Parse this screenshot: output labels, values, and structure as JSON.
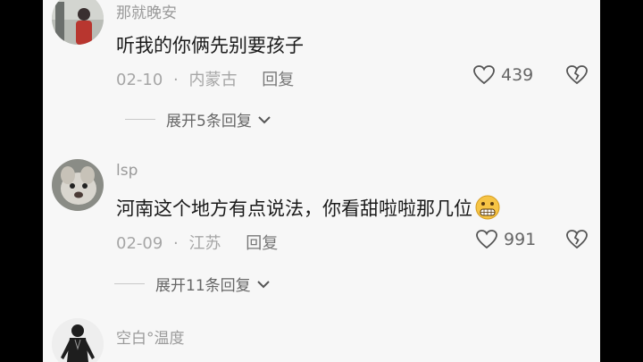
{
  "comments": [
    {
      "username": "那就晚安",
      "content": "听我的你俩先别要孩子",
      "date": "02-10",
      "location": "内蒙古",
      "reply_label": "回复",
      "likes": "439",
      "expand_label": "展开5条回复"
    },
    {
      "username": "lsp",
      "content": "河南这个地方有点说法，你看甜啦啦那几位",
      "date": "02-09",
      "location": "江苏",
      "reply_label": "回复",
      "likes": "991",
      "expand_label": "展开11条回复"
    },
    {
      "username": "空白°温度",
      "content": "",
      "date": "",
      "location": ""
    }
  ],
  "meta_separator": "·",
  "colors": {
    "background": "#f7f7f7",
    "text_primary": "#1a1a1a",
    "text_secondary": "#a6a6a6",
    "frame": "#000000"
  },
  "icons": {
    "like": "heart-outline-icon",
    "dislike": "broken-heart-icon",
    "expand": "chevron-down-icon",
    "emoji": "grimacing-emoji-icon"
  }
}
